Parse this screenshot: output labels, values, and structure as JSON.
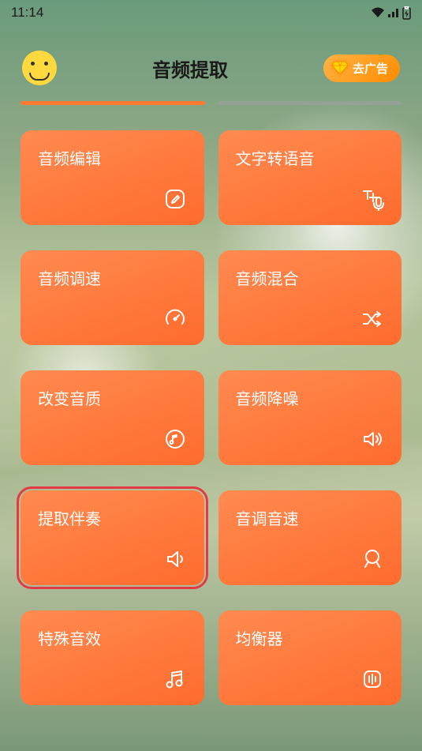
{
  "status": {
    "time": "11:14"
  },
  "header": {
    "title": "音频提取",
    "ad_label": "去广告"
  },
  "cards": [
    {
      "label": "音频编辑",
      "icon": "edit-icon"
    },
    {
      "label": "文字转语音",
      "icon": "text-to-speech-icon"
    },
    {
      "label": "音频调速",
      "icon": "speed-icon"
    },
    {
      "label": "音频混合",
      "icon": "shuffle-icon"
    },
    {
      "label": "改变音质",
      "icon": "quality-icon"
    },
    {
      "label": "音频降噪",
      "icon": "noise-reduce-icon"
    },
    {
      "label": "提取伴奏",
      "icon": "speaker-icon",
      "highlighted": true
    },
    {
      "label": "音调音速",
      "icon": "pitch-icon"
    },
    {
      "label": "特殊音效",
      "icon": "music-note-icon"
    },
    {
      "label": "均衡器",
      "icon": "equalizer-icon"
    }
  ]
}
